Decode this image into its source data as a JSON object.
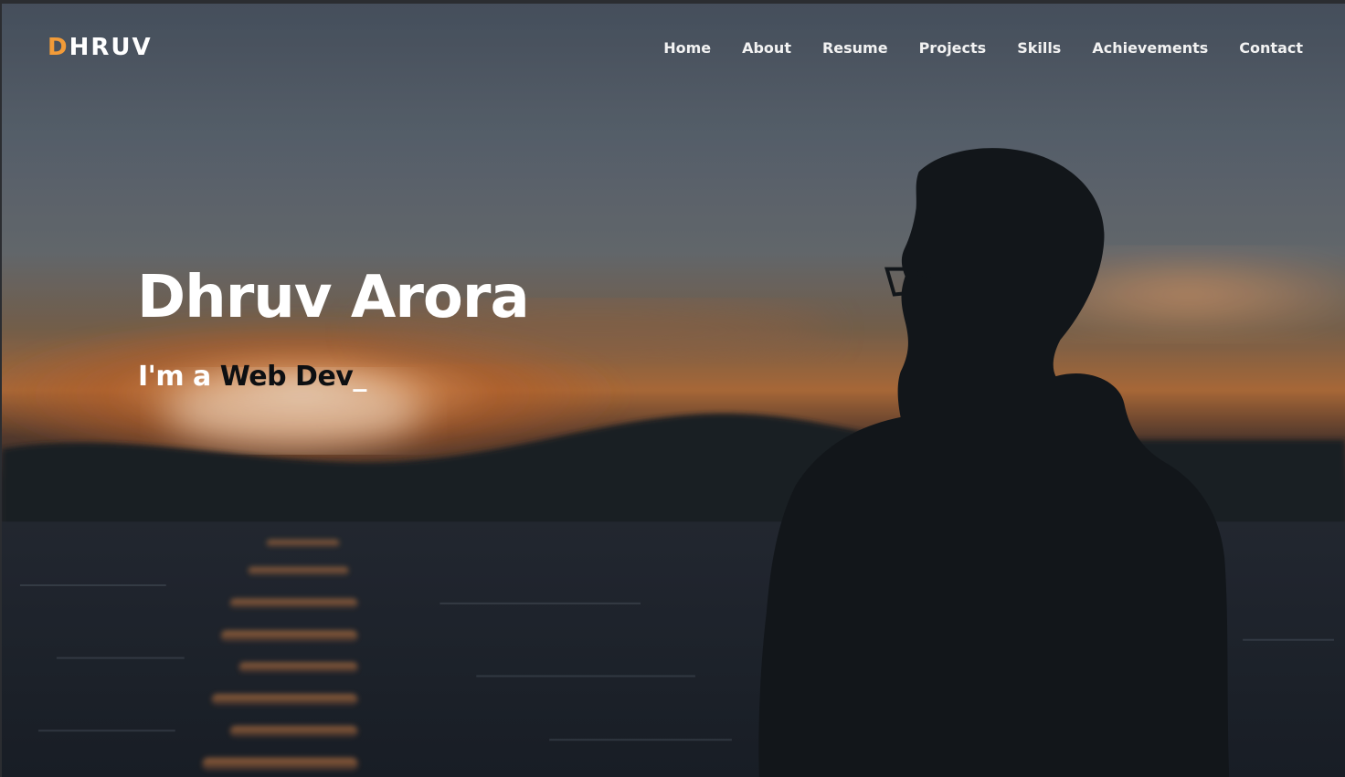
{
  "brand": {
    "logo_first": "D",
    "logo_rest": "HRUV",
    "accent_color": "#f29b38"
  },
  "nav": {
    "items": [
      "Home",
      "About",
      "Resume",
      "Projects",
      "Skills",
      "Achievements",
      "Contact"
    ]
  },
  "hero": {
    "title": "Dhruv Arora",
    "subtitle_prefix": "I'm a ",
    "subtitle_role": "Web Dev",
    "cursor": "_",
    "background": "sunset-lake-silhouette-photo"
  }
}
